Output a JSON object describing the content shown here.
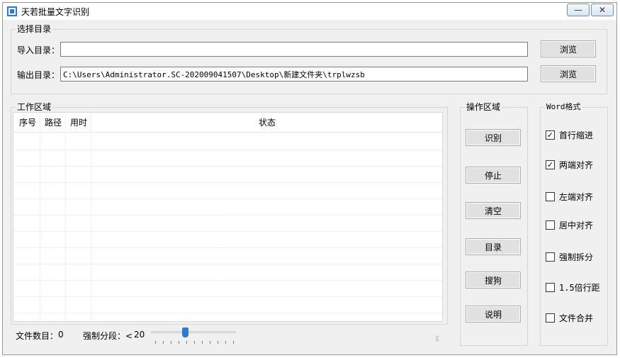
{
  "window": {
    "title": "天若批量文字识别",
    "minimize": "—",
    "close": "✕",
    "icon": "app-window-icon"
  },
  "select_dir": {
    "legend": "选择目录",
    "import_label": "导入目录：",
    "import_value": "",
    "output_label": "输出目录：",
    "output_value": "C:\\Users\\Administrator.SC-202009041507\\Desktop\\新建文件夹\\trplwzsb",
    "browse1": "浏览",
    "browse2": "浏览"
  },
  "work_area": {
    "legend": "工作区域",
    "columns": [
      "序号",
      "路径",
      "用时",
      "状态"
    ],
    "rows": []
  },
  "ops": {
    "legend": "操作区域",
    "buttons": [
      "识别",
      "停止",
      "清空",
      "目录",
      "搜狗",
      "说明"
    ]
  },
  "word": {
    "legend": "Word格式",
    "options": [
      {
        "label": "首行缩进",
        "checked": true
      },
      {
        "label": "两端对齐",
        "checked": true
      },
      {
        "label": "左端对齐",
        "checked": false
      },
      {
        "label": "居中对齐",
        "checked": false
      },
      {
        "label": "强制拆分",
        "checked": false
      },
      {
        "label": "1.5倍行距",
        "checked": false
      },
      {
        "label": "文件合并",
        "checked": false
      }
    ]
  },
  "status": {
    "file_count_label": "文件数目：",
    "file_count": "0",
    "split_label": "强制分段：<",
    "split_value": "20",
    "slider_fraction": 0.41
  },
  "colors": {
    "accent": "#2b7bd6",
    "window_bg": "#f0f0f0"
  }
}
